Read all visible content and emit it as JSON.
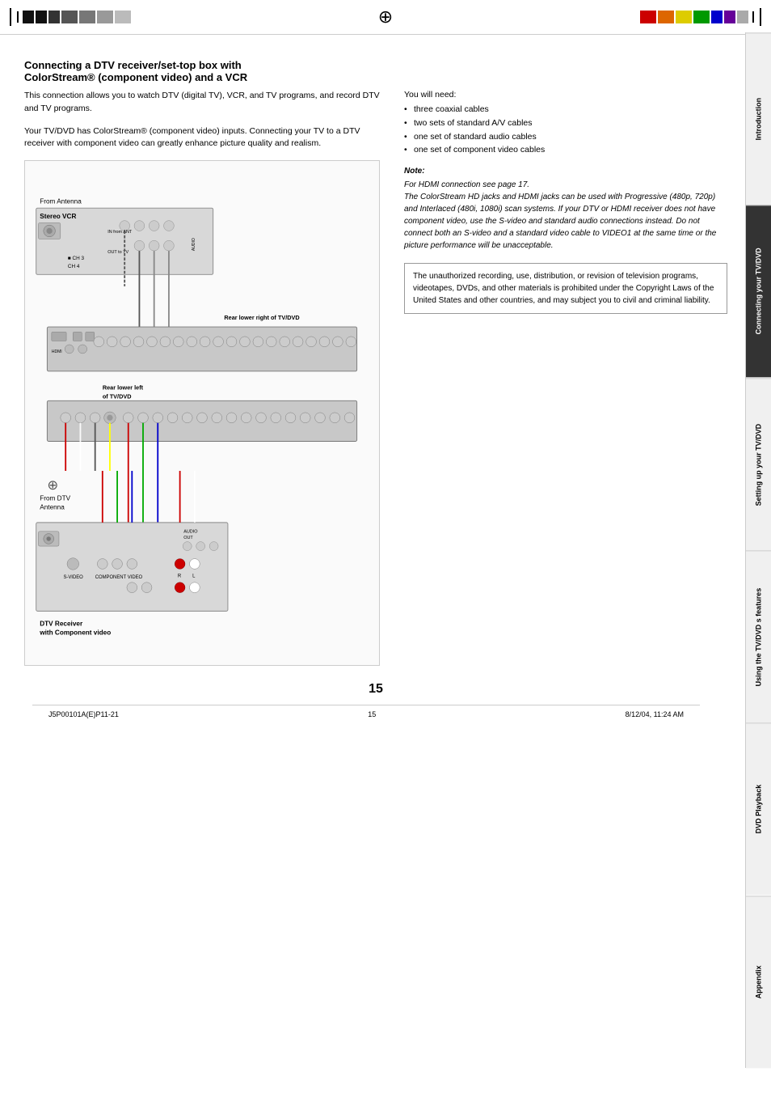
{
  "page": {
    "number": "15",
    "footer_left": "J5P00101A(E)P11-21",
    "footer_center": "15",
    "footer_right": "8/12/04, 11:24 AM"
  },
  "header": {
    "crosshair": "⊕"
  },
  "sidebar": {
    "tabs": [
      {
        "id": "introduction",
        "label": "Introduction",
        "active": false
      },
      {
        "id": "connecting",
        "label": "Connecting your TV/DVD",
        "active": true
      },
      {
        "id": "setting-up",
        "label": "Setting up your TV/DVD",
        "active": false
      },
      {
        "id": "features",
        "label": "Using the TV/DVD s features",
        "active": false
      },
      {
        "id": "dvd",
        "label": "DVD Playback",
        "active": false
      },
      {
        "id": "appendix",
        "label": "Appendix",
        "active": false
      }
    ]
  },
  "section": {
    "title_line1": "Connecting a DTV receiver/set-top box with",
    "title_line2": "ColorStream® (component video) and a VCR",
    "intro_text1": "This connection allows you to watch DTV (digital TV), VCR, and TV programs, and record DTV and TV programs.",
    "intro_text2": "Your TV/DVD has ColorStream® (component video) inputs. Connecting your TV to a DTV receiver with component video can greatly enhance picture quality and realism."
  },
  "you_will_need": {
    "label": "You will need:",
    "items": [
      "three coaxial cables",
      "two sets of standard A/V cables",
      "one set of standard audio cables",
      "one set of component video cables"
    ]
  },
  "note": {
    "title": "Note:",
    "body": "For HDMI connection see page 17.\nThe ColorStream HD jacks and HDMI jacks can be used with Progressive (480p, 720p) and Interlaced (480i, 1080i) scan systems. If your DTV or HDMI receiver does not have component video, use the S-video and standard audio connections instead. Do not connect both an S-video and a standard video cable to VIDEO1 at the same time or the picture performance will be unacceptable."
  },
  "warning": {
    "body": "The unauthorized recording, use, distribution, or revision of television programs, videotapes, DVDs, and other materials is prohibited under the Copyright Laws of the United States and other countries, and may subject you to civil and criminal liability."
  },
  "diagram": {
    "vcr_label": "Stereo VCR",
    "from_antenna": "From Antenna",
    "rear_lower_right": "Rear lower right of TV/DVD",
    "rear_lower_left": "Rear lower left\nof TV/DVD",
    "from_dtv": "From DTV\nAntenna",
    "dtv_label": "DTV Receiver\nwith Component video",
    "in_from_ant": "IN from ANT",
    "out_to_tv": "OUT to TV",
    "ch3": "CH 3",
    "ch4": "CH 4",
    "s_video": "S-VIDEO",
    "component_video": "COMPONENT VIDEO"
  },
  "colors": {
    "bar1": "#000000",
    "bar2": "#222222",
    "bar3": "#444444",
    "bar4": "#666666",
    "bar5": "#888888",
    "bar6": "#aaaaaa",
    "bar7": "#cccccc",
    "right_bar1": "#ff0000",
    "right_bar2": "#ff8800",
    "right_bar3": "#ffff00",
    "right_bar4": "#00aa00",
    "right_bar5": "#0000ff",
    "right_bar6": "#8800aa",
    "right_bar7": "#cccccc",
    "connecting_tab": "#333333"
  }
}
